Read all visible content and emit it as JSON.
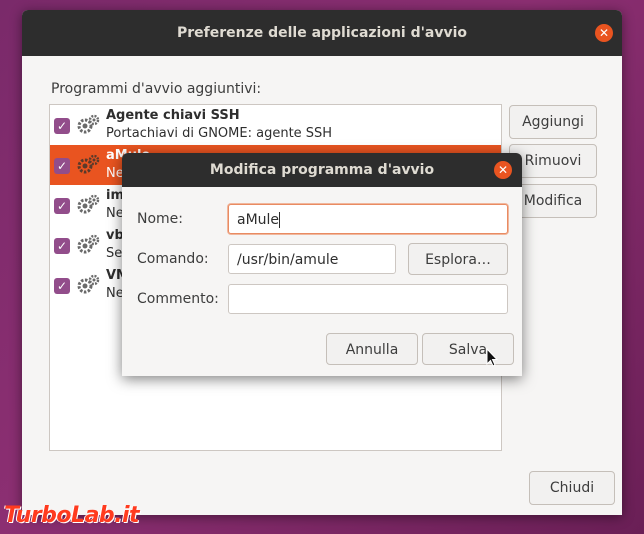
{
  "main_window": {
    "title": "Preferenze delle applicazioni d'avvio",
    "close_glyph": "✕",
    "section_label": "Programmi d'avvio aggiuntivi:",
    "checkbox_glyph": "✓",
    "programs": [
      {
        "name": "Agente chiavi SSH",
        "description": "Portachiavi di GNOME: agente SSH",
        "checked": true,
        "selected": false,
        "icon": "gear-icon"
      },
      {
        "name": "aMule",
        "description": "Ne",
        "checked": true,
        "selected": true,
        "icon": "gear-icon"
      },
      {
        "name": "im",
        "description": "Ne",
        "checked": true,
        "selected": false,
        "icon": "gear-icon"
      },
      {
        "name": "vb",
        "description": "Se",
        "checked": true,
        "selected": false,
        "icon": "gear-icon"
      },
      {
        "name": "VM",
        "description": "Ne",
        "checked": true,
        "selected": false,
        "icon": "gear-icon"
      }
    ],
    "buttons": {
      "add": "Aggiungi",
      "remove": "Rimuovi",
      "edit": "Modifica",
      "close": "Chiudi"
    }
  },
  "dialog": {
    "title": "Modifica programma d'avvio",
    "close_glyph": "✕",
    "name_label": "Nome:",
    "name_value": "aMule",
    "command_label": "Comando:",
    "command_value": "/usr/bin/amule",
    "browse_label": "Esplora…",
    "comment_label": "Commento:",
    "comment_value": "",
    "cancel_label": "Annulla",
    "save_label": "Salva"
  },
  "watermark": "TurboLab.it",
  "colors": {
    "accent": "#e95420",
    "checkbox": "#924d8b",
    "titlebar": "#2d2d2d"
  }
}
